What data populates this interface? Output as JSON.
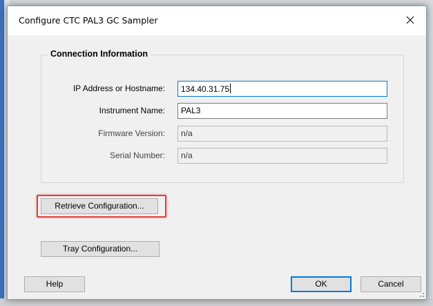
{
  "window": {
    "title": "Configure CTC PAL3 GC Sampler",
    "close_glyph": "✕"
  },
  "connection": {
    "legend": "Connection Information",
    "ip": {
      "label": "IP Address or Hostname:",
      "value": "134.40.31.75"
    },
    "instrument": {
      "label": "Instrument Name:",
      "value": "PAL3"
    },
    "firmware": {
      "label": "Firmware Version:",
      "value": "n/a"
    },
    "serial": {
      "label": "Serial Number:",
      "value": "n/a"
    }
  },
  "buttons": {
    "retrieve": "Retrieve Configuration...",
    "tray": "Tray Configuration...",
    "help": "Help",
    "ok": "OK",
    "cancel": "Cancel"
  },
  "colors": {
    "highlight": "#e0403a",
    "focus": "#0078d7"
  }
}
